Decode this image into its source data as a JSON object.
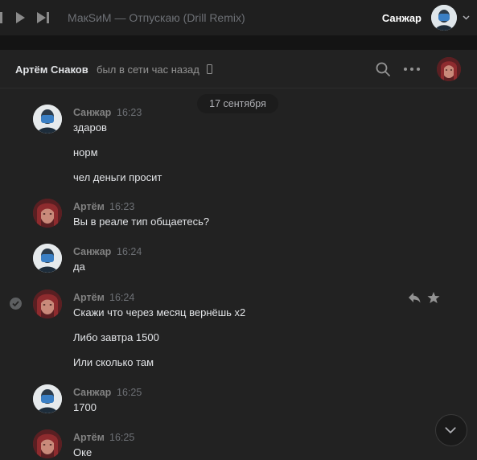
{
  "player": {
    "track": "МакSиМ — Отпускаю (Drill Remix)"
  },
  "user": {
    "name": "Санжар"
  },
  "chat": {
    "peer_name": "Артём Снаков",
    "peer_status": "был в сети час назад",
    "date": "17 сентября"
  },
  "messages": [
    {
      "author": "Санжар",
      "time": "16:23",
      "avatar": "sanzhar",
      "lines": [
        "здаров",
        "норм",
        "чел деньги просит"
      ]
    },
    {
      "author": "Артём",
      "time": "16:23",
      "avatar": "artem",
      "lines": [
        "Вы в реале тип общаетесь?"
      ]
    },
    {
      "author": "Санжар",
      "time": "16:24",
      "avatar": "sanzhar",
      "lines": [
        "да"
      ]
    },
    {
      "author": "Артём",
      "time": "16:24",
      "avatar": "artem",
      "lines": [
        "Скажи что через месяц вернёшь х2",
        "Либо завтра 1500",
        "Или сколько там"
      ]
    },
    {
      "author": "Санжар",
      "time": "16:25",
      "avatar": "sanzhar",
      "lines": [
        "1700"
      ]
    },
    {
      "author": "Артём",
      "time": "16:25",
      "avatar": "artem",
      "lines": [
        "Оке"
      ]
    }
  ],
  "colors": {
    "background": "#222222",
    "topbar": "#1f1f1f",
    "text": "#e1e3e6",
    "muted": "#828282"
  }
}
